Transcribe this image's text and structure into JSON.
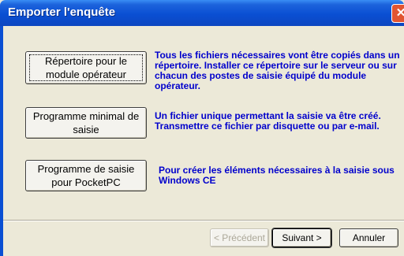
{
  "window": {
    "title": "Emporter l'enquête",
    "close_glyph": "✕"
  },
  "options": [
    {
      "button_label": "Répertoire pour le module opérateur",
      "description": "Tous les fichiers nécessaires vont être copiés dans un répertoire. Installer ce répertoire sur le serveur ou sur chacun des postes de saisie équipé du module opérateur."
    },
    {
      "button_label": "Programme minimal de saisie",
      "description": "Un fichier unique permettant la saisie va être créé. Transmettre ce fichier par disquette ou par e-mail."
    },
    {
      "button_label": "Programme de saisie pour PocketPC",
      "description": "Pour créer les éléments nécessaires à la saisie sous Windows CE"
    }
  ],
  "navigation": {
    "back_label": "< Précédent",
    "next_label": "Suivant >",
    "cancel_label": "Annuler"
  }
}
